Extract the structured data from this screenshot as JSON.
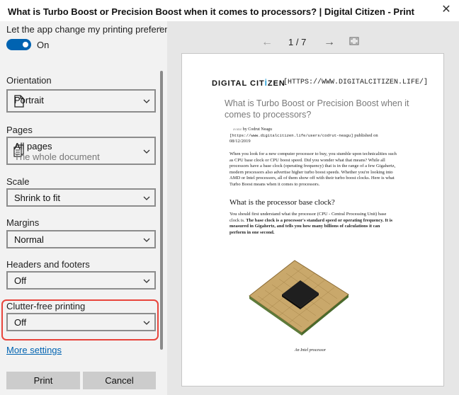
{
  "window": {
    "title": "What is Turbo Boost or Precision Boost when it comes to processors? | Digital Citizen - Print",
    "close_icon": "close-icon"
  },
  "settings": {
    "preferences_label": "Let the app change my printing preferences",
    "preferences_state": "On",
    "orientation": {
      "label": "Orientation",
      "value": "Portrait"
    },
    "pages": {
      "label": "Pages",
      "value": "All pages",
      "sub": "The whole document"
    },
    "scale": {
      "label": "Scale",
      "value": "Shrink to fit"
    },
    "margins": {
      "label": "Margins",
      "value": "Normal"
    },
    "headers": {
      "label": "Headers and footers",
      "value": "Off"
    },
    "clutter": {
      "label": "Clutter-free printing",
      "value": "Off"
    },
    "more_settings": "More settings",
    "print_button": "Print",
    "cancel_button": "Cancel"
  },
  "preview": {
    "page_indicator": "1 / 7",
    "logo": "DIGITAL CITIZEN",
    "url_header": "[HTTPS://WWW.DIGITALCITIZEN.LIFE/]",
    "article_title": "What is Turbo Boost or Precision Boost when it comes to processors?",
    "byline_img": "avatar",
    "byline": "by Codrut Neagu",
    "byline_url": "[https://www.digitalcitizen.life/users/codrut-neagu]",
    "byline_date_prefix": "published on",
    "byline_date": "08/12/2019",
    "paragraph1": "When you look for a new computer processor to buy, you stumble upon technicalities such as CPU base clock or CPU boost speed. Did you wonder what that means? While all processors have a base clock (operating frequency) that is in the range of a few Gigahertz, modern processors also advertise higher turbo boost speeds. Whether you're looking into AMD or Intel processors, all of them show off with their turbo boost clocks. Here is what Turbo Boost means when it comes to processors.",
    "heading2": "What is the processor base clock?",
    "paragraph2_plain": "You should first understand what the processor (CPU - Central Processing Unit) base clock is.",
    "paragraph2_bold": "The base clock is a processor's standard speed or operating frequency. It is measured in Gigahertz, and tells you how many billions of calculations it can perform in one second.",
    "caption": "An Intel processor"
  },
  "colors": {
    "accent": "#0063b1",
    "highlight": "#e8453c",
    "panel": "#f2f2f2",
    "preview_bg": "#e6e6e6"
  }
}
